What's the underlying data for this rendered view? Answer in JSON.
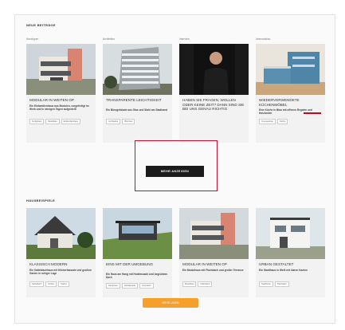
{
  "sections": {
    "first_title": "NEUE BEITRÄGE",
    "second_title": "HAUSBEISPIELE"
  },
  "first_row": [
    {
      "category": "Haustypen",
      "title": "MODULAR IN WEITEN OP",
      "desc": "Ein Einfamilienhaus aus Modulen, vorgefertigt im Werk und in wenigen Tagen aufgestellt",
      "tags": [
        "Fertighaus",
        "Modulbau",
        "Einfamilienhaus"
      ]
    },
    {
      "category": "Architektur",
      "title": "TRANSPARENTE LEICHTIGKEIT",
      "desc": "Ein Bürogebäude aus Glas und Stahl am Stadtrand",
      "tags": [
        "Architektur",
        "Bürobau"
      ]
    },
    {
      "category": "Interview",
      "title": "HABEN SIE FRAGEN, WOLLEN ODER KEINE ZEIT? DANN SIND SIE BEI UNS GENAU RICHTIG",
      "desc": "",
      "tags": []
    },
    {
      "category": "Innenausbau",
      "title": "WIEDERVERWENDETE KÜCHENMÖBEL",
      "desc": "Eine Küche in Blau mit offenen Regalen und Holzboden",
      "tags": [
        "Innenausbau",
        "Küche"
      ]
    }
  ],
  "more_button": "MEHR ANZEIGEN",
  "second_row": [
    {
      "title": "KLASSISCH MODERN",
      "desc": "Ein Satteldachhaus mit Klinkerfassade und großem Garten in ruhiger Lage",
      "tags": [
        "Satteldach",
        "Klinker",
        "Garten"
      ]
    },
    {
      "title": "EINS MIT DER UMGEBUNG",
      "desc": "Ein Haus am Hang mit Holzfassade und begrüntem Dach",
      "tags": [
        "Hanghaus",
        "Holzfassade",
        "Gründach"
      ]
    },
    {
      "title": "MODULAR IN WEITEN OP",
      "desc": "Ein Modulhaus mit Flachdach und großer Terrasse",
      "tags": [
        "Modulbau",
        "Flachdach"
      ]
    },
    {
      "title": "URBAN GESTALTET",
      "desc": "Ein Stadthaus in Weiß mit klaren Kanten",
      "tags": [
        "Stadthaus",
        "Flachdach"
      ]
    }
  ],
  "load_more_button": "MEHR LADEN",
  "colors": {
    "highlight_box": "#c8102e",
    "red_marker": "#d0021b",
    "primary_button": "#1b1b1b",
    "accent_button": "#f6a02b"
  }
}
